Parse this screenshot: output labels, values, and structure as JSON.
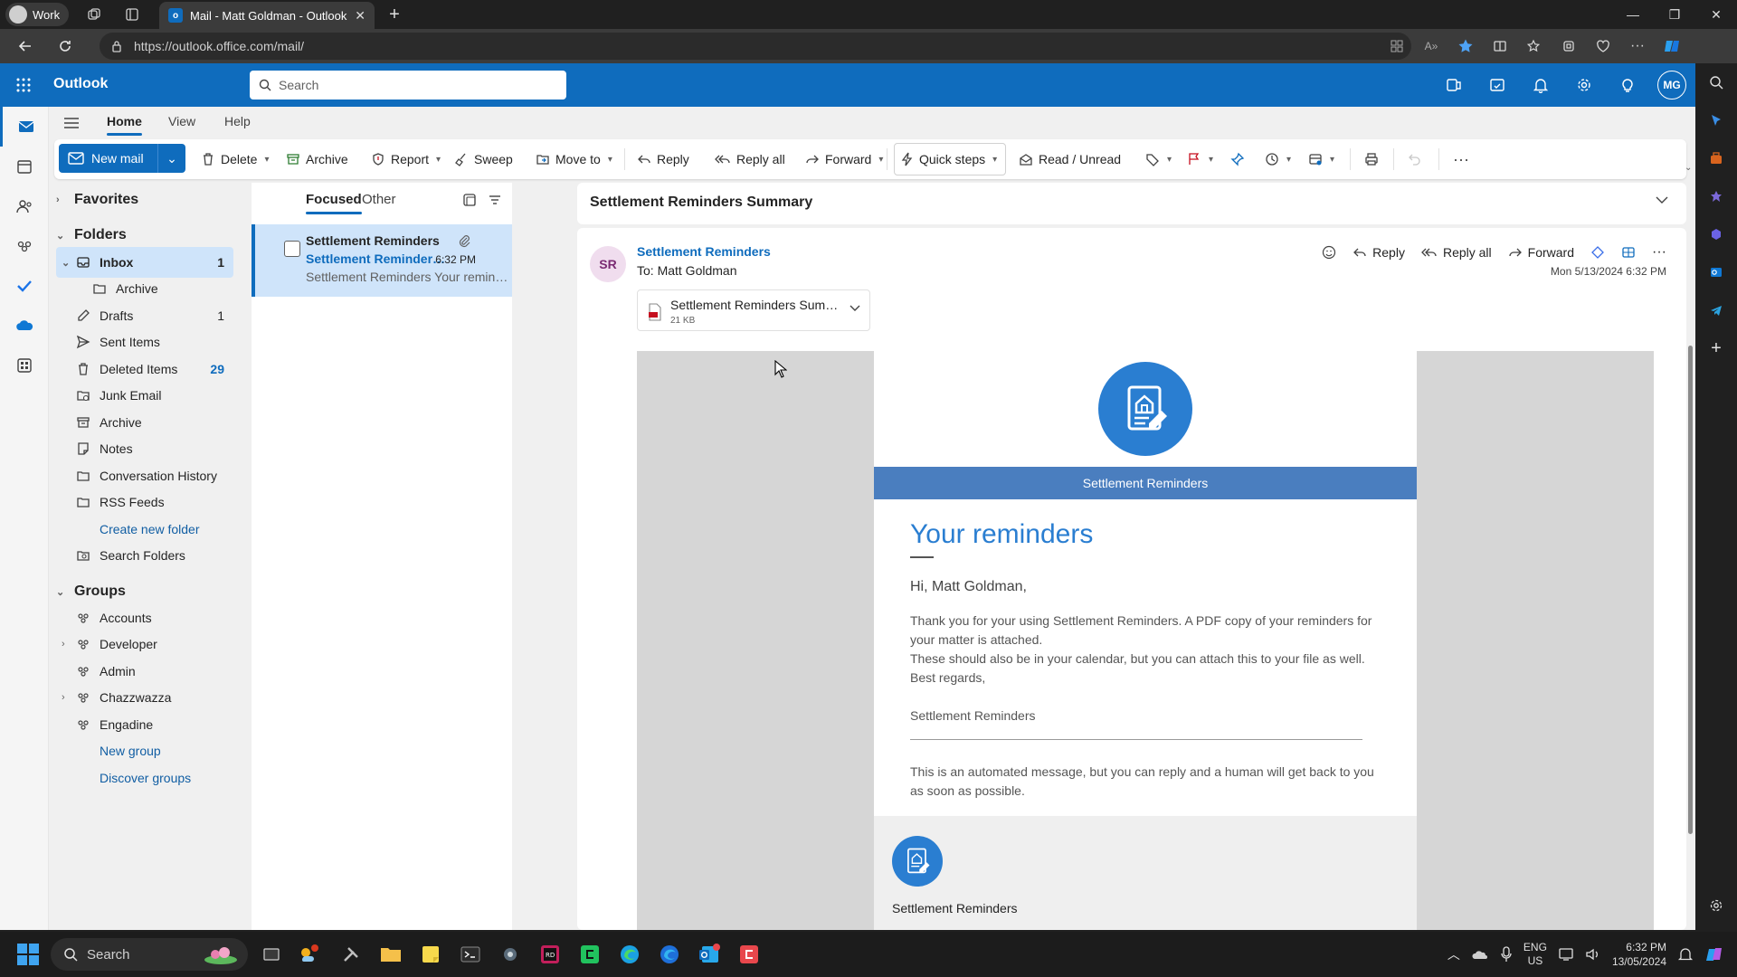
{
  "browser": {
    "profile": "Work",
    "tab_title": "Mail - Matt Goldman - Outlook",
    "url": "https://outlook.office.com/mail/"
  },
  "app": {
    "name": "Outlook",
    "search_placeholder": "Search",
    "user_initials": "MG",
    "brand_color": "#0f6cbd"
  },
  "ribbon_tabs": [
    "Home",
    "View",
    "Help"
  ],
  "ribbon": {
    "new_mail": "New mail",
    "delete": "Delete",
    "archive": "Archive",
    "report": "Report",
    "sweep": "Sweep",
    "move_to": "Move to",
    "reply": "Reply",
    "reply_all": "Reply all",
    "forward": "Forward",
    "quick_steps": "Quick steps",
    "read_unread": "Read / Unread"
  },
  "folders": {
    "favorites_label": "Favorites",
    "folders_label": "Folders",
    "items": [
      {
        "label": "Inbox",
        "count": "1",
        "icon": "inbox-icon"
      },
      {
        "label": "Archive",
        "count": "",
        "icon": "folder-icon"
      },
      {
        "label": "Drafts",
        "count": "1",
        "icon": "pencil-icon"
      },
      {
        "label": "Sent Items",
        "count": "",
        "icon": "send-icon"
      },
      {
        "label": "Deleted Items",
        "count": "29",
        "icon": "trash-icon"
      },
      {
        "label": "Junk Email",
        "count": "",
        "icon": "junk-icon"
      },
      {
        "label": "Archive",
        "count": "",
        "icon": "archive-icon"
      },
      {
        "label": "Notes",
        "count": "",
        "icon": "note-icon"
      },
      {
        "label": "Conversation History",
        "count": "",
        "icon": "folder-icon"
      },
      {
        "label": "RSS Feeds",
        "count": "",
        "icon": "folder-icon"
      }
    ],
    "create_new_folder": "Create new folder",
    "search_folders": "Search Folders",
    "groups_label": "Groups",
    "groups": [
      "Accounts",
      "Developer",
      "Admin",
      "Chazzwazza",
      "Engadine"
    ],
    "new_group": "New group",
    "discover_groups": "Discover groups"
  },
  "message_list": {
    "tab_focused": "Focused",
    "tab_other": "Other",
    "item": {
      "from": "Settlement Reminders",
      "subject": "Settlement Reminders Summary",
      "time": "6:32 PM",
      "preview": "Settlement Reminders Your reminders..."
    }
  },
  "reading": {
    "subject": "Settlement Reminders Summary",
    "avatar": "SR",
    "sender": "Settlement Reminders",
    "to": "To:  Matt Goldman",
    "date": "Mon 5/13/2024 6:32 PM",
    "reply": "Reply",
    "reply_all": "Reply all",
    "forward": "Forward",
    "attachment_name": "Settlement Reminders Summary.pdf",
    "attachment_size": "21 KB"
  },
  "email": {
    "banner": "Settlement Reminders",
    "heading": "Your reminders",
    "greeting": "Hi, Matt Goldman,",
    "p1": "Thank you for your using Settlement Reminders. A PDF copy of your reminders for your matter is attached.",
    "p2": "These should also be in your calendar, but you can attach this to your file as well.",
    "p3": "Best regards,",
    "signoff": "Settlement Reminders",
    "automated": "This is an automated message, but you can reply and a human will get back to you as soon as possible.",
    "footer_name": "Settlement Reminders"
  },
  "taskbar": {
    "search": "Search",
    "lang_top": "ENG",
    "lang_bottom": "US",
    "time": "6:32 PM",
    "date": "13/05/2024"
  }
}
